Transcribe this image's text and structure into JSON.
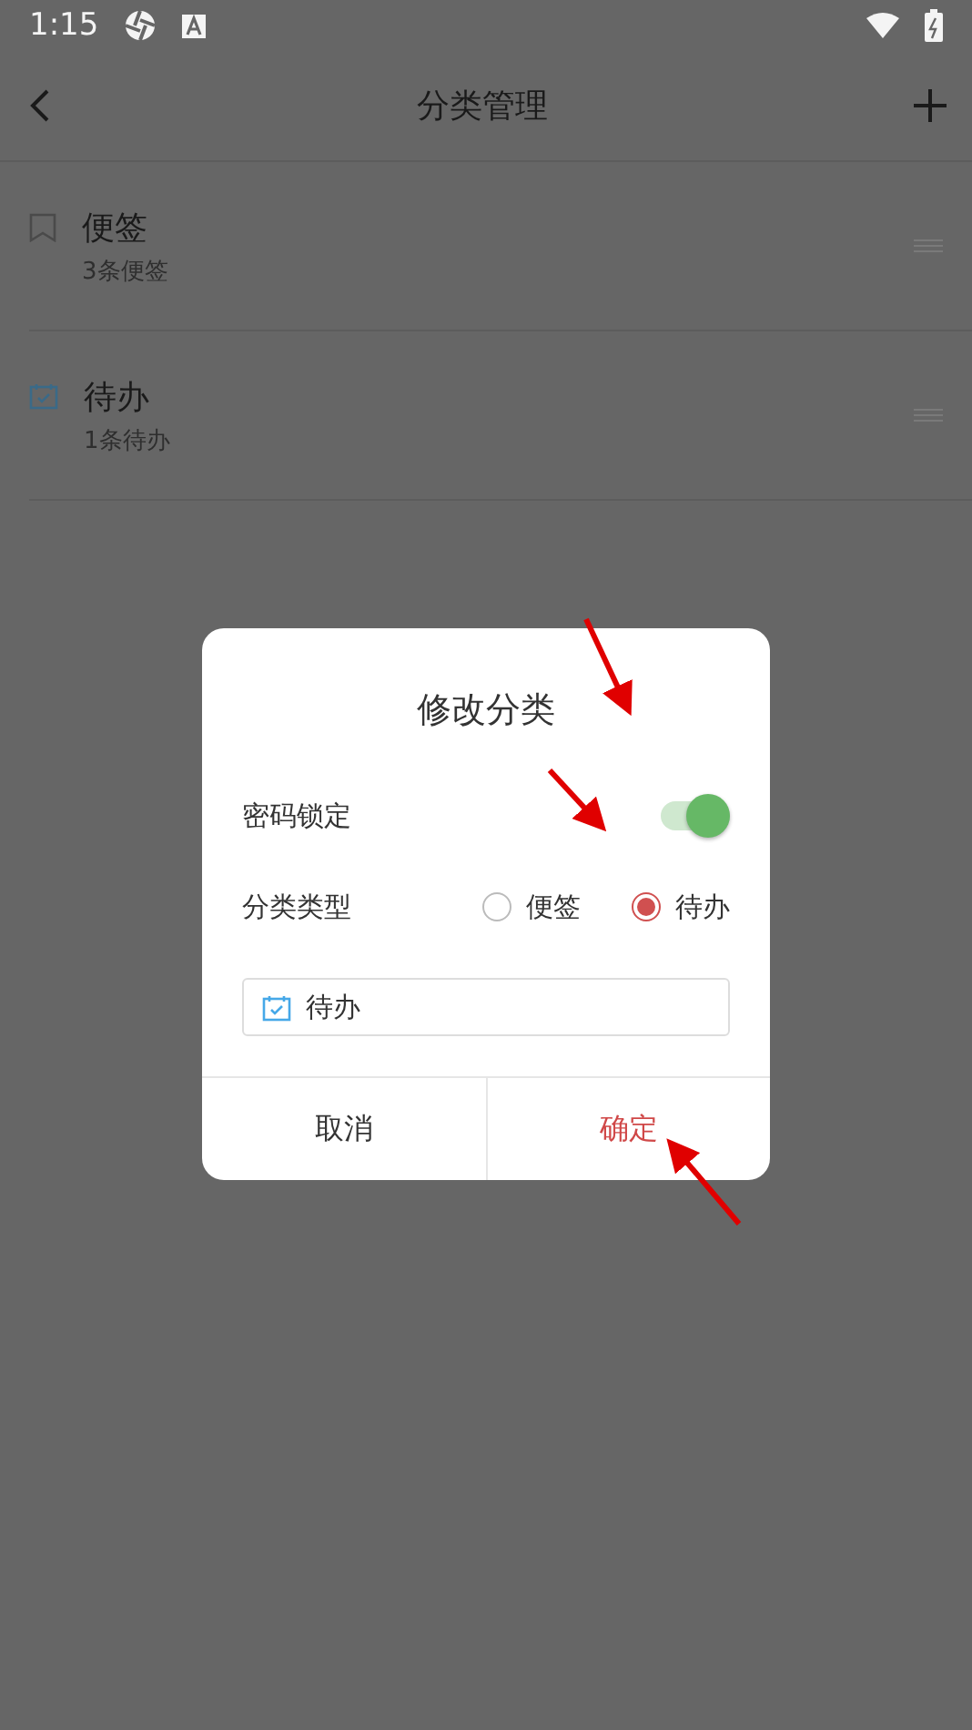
{
  "status_bar": {
    "time": "1:15"
  },
  "header": {
    "title": "分类管理"
  },
  "categories": [
    {
      "name": "便签",
      "count": "3条便签",
      "kind": "note"
    },
    {
      "name": "待办",
      "count": "1条待办",
      "kind": "todo"
    }
  ],
  "dialog": {
    "title": "修改分类",
    "lock": {
      "label": "密码锁定",
      "on": true
    },
    "type": {
      "label": "分类类型",
      "options": [
        {
          "label": "便签",
          "selected": false
        },
        {
          "label": "待办",
          "selected": true
        }
      ]
    },
    "field": {
      "value": "待办",
      "kind": "todo"
    },
    "buttons": [
      {
        "label": "取消",
        "kind": "cancel"
      },
      {
        "label": "确定",
        "kind": "confirm"
      }
    ]
  }
}
